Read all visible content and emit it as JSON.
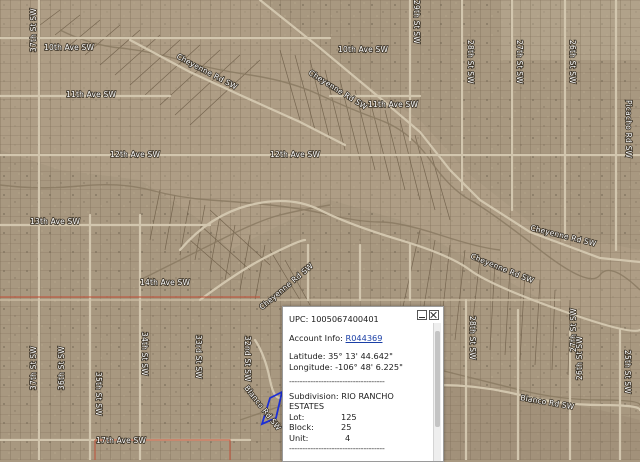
{
  "map": {
    "colors": {
      "terrain": "#a89880",
      "parcel_line": "#7a6a52",
      "road": "#d2c6ae",
      "boundary": "#c0573e",
      "selection": "#1c2fd6"
    },
    "road_labels": [
      {
        "id": "r10w",
        "text": "10th Ave SW"
      },
      {
        "id": "r10e",
        "text": "10th Ave SW"
      },
      {
        "id": "r11w",
        "text": "11th Ave SW"
      },
      {
        "id": "r11e",
        "text": "11th Ave SW"
      },
      {
        "id": "r12w",
        "text": "12th Ave SW"
      },
      {
        "id": "r12e",
        "text": "12th Ave SW"
      },
      {
        "id": "r13",
        "text": "13th Ave SW"
      },
      {
        "id": "r14",
        "text": "14th Ave SW"
      },
      {
        "id": "r17",
        "text": "17th Ave SW"
      },
      {
        "id": "cheA",
        "text": "Cheyenne Rd SW"
      },
      {
        "id": "cheB",
        "text": "Cheyenne Rd SW"
      },
      {
        "id": "cheC",
        "text": "Cheyenne Rd SW"
      },
      {
        "id": "cheD",
        "text": "Cheyenne Rd SW"
      },
      {
        "id": "cheE",
        "text": "Cheyenne Rd SW"
      },
      {
        "id": "blA",
        "text": "Blanco Rd SW"
      },
      {
        "id": "blB",
        "text": "Blanco Rd SW"
      },
      {
        "id": "s37a",
        "text": "37th St SW"
      },
      {
        "id": "s37b",
        "text": "37th St SW"
      },
      {
        "id": "s36",
        "text": "36th St SW"
      },
      {
        "id": "s35",
        "text": "35th St SW"
      },
      {
        "id": "s34",
        "text": "34th St SW"
      },
      {
        "id": "s33",
        "text": "33rd St SW"
      },
      {
        "id": "s32",
        "text": "32nd St SW"
      },
      {
        "id": "s29",
        "text": "29th St SW"
      },
      {
        "id": "s28a",
        "text": "28th St SW"
      },
      {
        "id": "s28b",
        "text": "28th St SW"
      },
      {
        "id": "s27a",
        "text": "27th St SW"
      },
      {
        "id": "s27b",
        "text": "27th St SW"
      },
      {
        "id": "s26a",
        "text": "26th St SW"
      },
      {
        "id": "s26b",
        "text": "26th St SW"
      },
      {
        "id": "s25",
        "text": "25th St SW"
      },
      {
        "id": "pica",
        "text": "Picacho Rd SW"
      }
    ]
  },
  "popup": {
    "upc_label": "UPC:",
    "upc_value": "1005067400401",
    "account_label": "Account Info:",
    "account_link": "R044369",
    "latitude_label": "Latitude:",
    "latitude_value": "35° 13' 44.642\"",
    "longitude_label": "Longitude:",
    "longitude_value": "-106° 48' 6.225\"",
    "separator": "------------------------------------",
    "subdivision_label": "Subdivision:",
    "subdivision_value": "RIO RANCHO ESTATES",
    "lot_label": "Lot:",
    "lot_value": "125",
    "block_label": "Block:",
    "block_value": "25",
    "unit_label": "Unit:",
    "unit_value": "4"
  }
}
